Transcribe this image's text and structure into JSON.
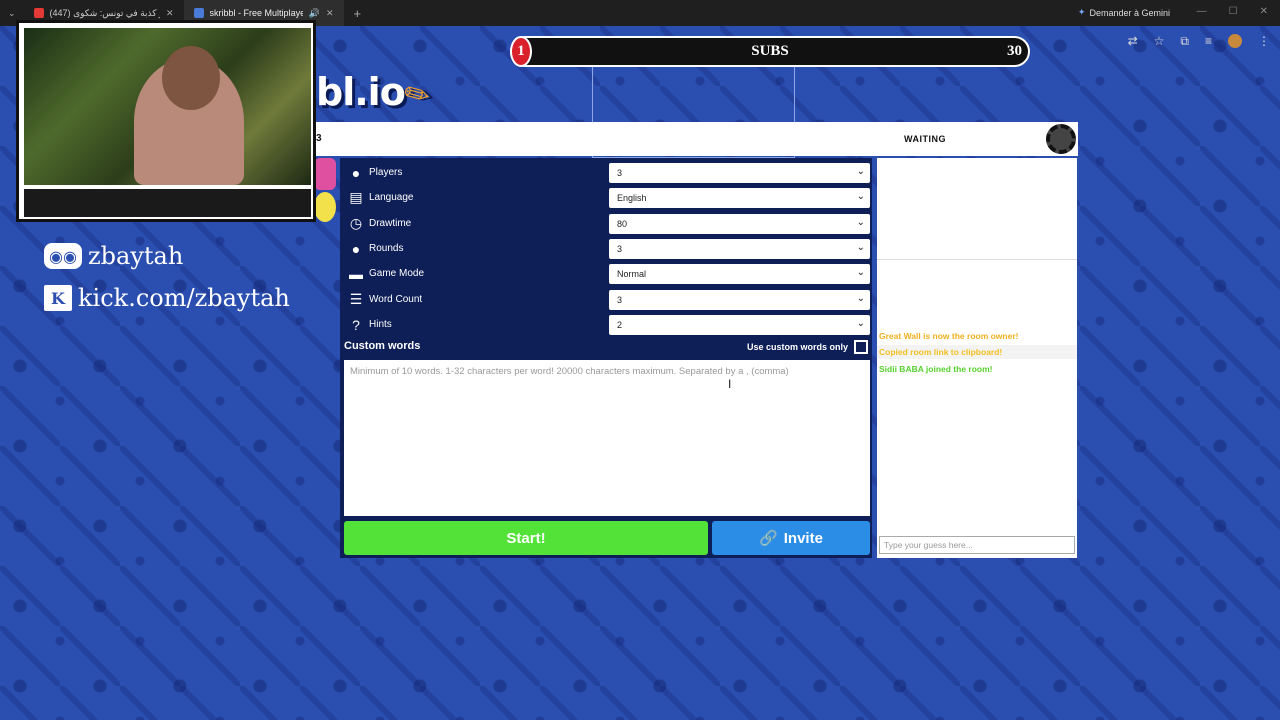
{
  "browser": {
    "tabs": [
      {
        "title": "(447) أكبر كذبة في تونس: شكوى",
        "active": false,
        "favicon_color": "#e53935"
      },
      {
        "title": "skribbl - Free Multiplayer Drawing",
        "active": true,
        "favicon_color": "#4a7bd8"
      }
    ],
    "new_tab": "+",
    "gemini": "Demander à Gemini"
  },
  "overlay": {
    "subs": {
      "current": "1",
      "label": "SUBS",
      "goal": "30"
    },
    "socials": [
      {
        "icon": "discord-icon",
        "text": "zbaytah"
      },
      {
        "icon": "kick-icon",
        "text": "kick.com/zbaytah"
      }
    ]
  },
  "game": {
    "logo": "bl.io",
    "round_partial": "3",
    "status": "WAITING",
    "settings": [
      {
        "icon": "players-icon",
        "glyph": "●",
        "label": "Players",
        "value": "3"
      },
      {
        "icon": "language-icon",
        "glyph": "▤",
        "label": "Language",
        "value": "English"
      },
      {
        "icon": "clock-icon",
        "glyph": "◷",
        "label": "Drawtime",
        "value": "80"
      },
      {
        "icon": "rounds-icon",
        "glyph": "●",
        "label": "Rounds",
        "value": "3"
      },
      {
        "icon": "gamemode-icon",
        "glyph": "▬",
        "label": "Game Mode",
        "value": "Normal"
      },
      {
        "icon": "wordcount-icon",
        "glyph": "☰",
        "label": "Word Count",
        "value": "3"
      },
      {
        "icon": "hints-icon",
        "glyph": "?",
        "label": "Hints",
        "value": "2"
      }
    ],
    "custom_words_title": "Custom words",
    "custom_only_label": "Use custom words only",
    "custom_placeholder": "Minimum of 10 words. 1-32 characters per word! 20000 characters maximum. Separated by a , (comma)",
    "start_label": "Start!",
    "invite_label": "Invite"
  },
  "chat": {
    "messages": [
      {
        "text": "Great Wall is now the room owner!",
        "color": "#f0b020"
      },
      {
        "text": "Copied room link to clipboard!",
        "color": "#f0c020"
      },
      {
        "text": "Sidii BABA joined the room!",
        "color": "#56d12e"
      }
    ],
    "input_placeholder": "Type your guess here..."
  }
}
